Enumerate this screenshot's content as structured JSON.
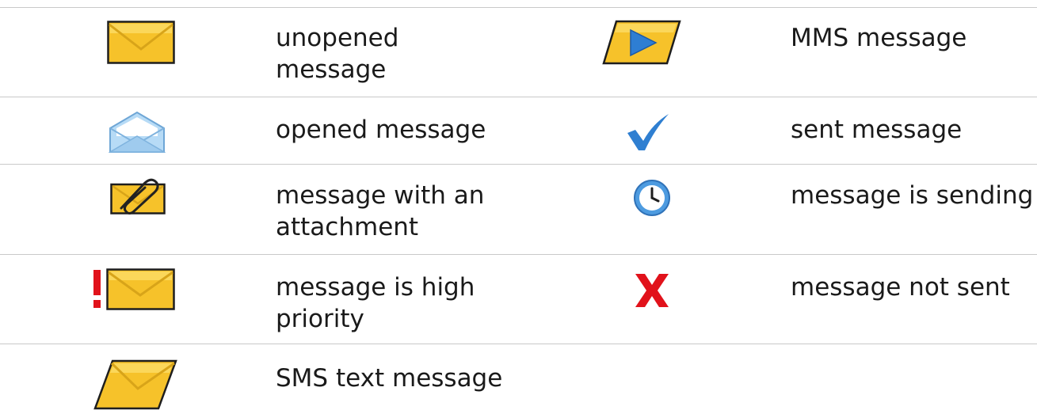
{
  "legend": {
    "rows": [
      {
        "left": {
          "icon": "unopened-message-icon",
          "label_lines": [
            "unopened",
            "message"
          ]
        },
        "right": {
          "icon": "mms-message-icon",
          "label_lines": [
            "MMS message"
          ]
        }
      },
      {
        "left": {
          "icon": "opened-message-icon",
          "label_lines": [
            "opened message"
          ]
        },
        "right": {
          "icon": "sent-checkmark-icon",
          "label_lines": [
            "sent message"
          ]
        }
      },
      {
        "left": {
          "icon": "attachment-message-icon",
          "label_lines": [
            "message with an",
            "attachment"
          ]
        },
        "right": {
          "icon": "sending-clock-icon",
          "label_lines": [
            "message is sending"
          ]
        }
      },
      {
        "left": {
          "icon": "high-priority-message-icon",
          "label_lines": [
            "message is high",
            "priority"
          ]
        },
        "right": {
          "icon": "not-sent-x-icon",
          "label_lines": [
            "message not sent"
          ]
        }
      },
      {
        "left": {
          "icon": "sms-message-icon",
          "label_lines": [
            "SMS text message"
          ]
        }
      }
    ]
  },
  "colors": {
    "envelope_yellow": "#f6c22a",
    "envelope_outline": "#1e1e1e",
    "opened_blue": "#9fcbee",
    "check_blue": "#2f7fd1",
    "clock_blue": "#4d9be0",
    "alert_red": "#e1121b",
    "rule_gray": "#c9c9c9"
  }
}
